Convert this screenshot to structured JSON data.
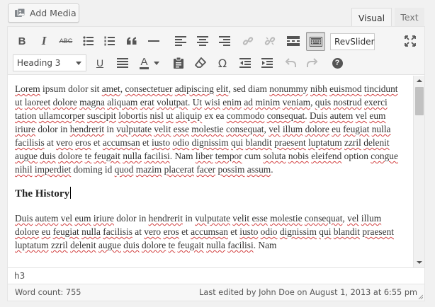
{
  "add_media": {
    "label": "Add Media",
    "icon": "media-icon"
  },
  "tabs": [
    {
      "label": "Visual",
      "active": true
    },
    {
      "label": "Text",
      "active": false
    }
  ],
  "toolbar": {
    "row1": [
      "bold",
      "italic",
      "strikethrough",
      "bullet-list",
      "numbered-list",
      "blockquote",
      "horizontal-rule",
      "align-left",
      "align-center",
      "align-right",
      "insert-link",
      "remove-link",
      "read-more",
      "toolbar-toggle",
      "revslider",
      "fullscreen"
    ],
    "row2": [
      "format-select",
      "underline",
      "justify",
      "text-color",
      "paste-as-text",
      "clear-formatting",
      "special-character",
      "decrease-indent",
      "increase-indent",
      "undo",
      "redo",
      "help"
    ],
    "bold_glyph": "B",
    "italic_glyph": "I",
    "strike_glyph": "ABC",
    "underline_glyph": "U",
    "color_glyph": "A",
    "omega_glyph": "Ω",
    "help_glyph": "?",
    "revslider_label": "RevSlider",
    "format_value": "Heading 3"
  },
  "content": {
    "paragraph1": [
      {
        "t": "Lorem",
        "sp": true
      },
      {
        "t": " ipsum dolor sit ",
        "sp": false
      },
      {
        "t": "amet",
        "sp": true
      },
      {
        "t": ", ",
        "sp": false
      },
      {
        "t": "consectetuer",
        "sp": true
      },
      {
        "t": " ",
        "sp": false
      },
      {
        "t": "adipiscing",
        "sp": true
      },
      {
        "t": " ",
        "sp": false
      },
      {
        "t": "elit",
        "sp": true
      },
      {
        "t": ", sed diam ",
        "sp": false
      },
      {
        "t": "nonummy",
        "sp": true
      },
      {
        "t": " ",
        "sp": false
      },
      {
        "t": "nibh",
        "sp": true
      },
      {
        "t": " ",
        "sp": false
      },
      {
        "t": "euismod",
        "sp": true
      },
      {
        "t": " ",
        "sp": false
      },
      {
        "t": "tincidunt",
        "sp": true
      },
      {
        "t": " ",
        "sp": false
      },
      {
        "t": "ut",
        "sp": true
      },
      {
        "t": " ",
        "sp": false
      },
      {
        "t": "laoreet",
        "sp": true
      },
      {
        "t": " ",
        "sp": false
      },
      {
        "t": "dolore",
        "sp": true
      },
      {
        "t": " ",
        "sp": false
      },
      {
        "t": "magna",
        "sp": true
      },
      {
        "t": " ",
        "sp": false
      },
      {
        "t": "aliquam",
        "sp": true
      },
      {
        "t": " ",
        "sp": false
      },
      {
        "t": "erat",
        "sp": true
      },
      {
        "t": " ",
        "sp": false
      },
      {
        "t": "volutpat",
        "sp": true
      },
      {
        "t": ". ",
        "sp": false
      },
      {
        "t": "Ut",
        "sp": true
      },
      {
        "t": " ",
        "sp": false
      },
      {
        "t": "wisi",
        "sp": true
      },
      {
        "t": " ",
        "sp": false
      },
      {
        "t": "enim",
        "sp": true
      },
      {
        "t": " ",
        "sp": false
      },
      {
        "t": "ad",
        "sp": true
      },
      {
        "t": " ",
        "sp": false
      },
      {
        "t": "minim",
        "sp": true
      },
      {
        "t": " ",
        "sp": false
      },
      {
        "t": "veniam",
        "sp": true
      },
      {
        "t": ", ",
        "sp": false
      },
      {
        "t": "quis",
        "sp": true
      },
      {
        "t": " ",
        "sp": false
      },
      {
        "t": "nostrud",
        "sp": true
      },
      {
        "t": " ",
        "sp": false
      },
      {
        "t": "exerci",
        "sp": true
      },
      {
        "t": " ",
        "sp": false
      },
      {
        "t": "tation",
        "sp": true
      },
      {
        "t": " ",
        "sp": false
      },
      {
        "t": "ullamcorper",
        "sp": true
      },
      {
        "t": " ",
        "sp": false
      },
      {
        "t": "suscipit",
        "sp": true
      },
      {
        "t": " ",
        "sp": false
      },
      {
        "t": "lobortis",
        "sp": true
      },
      {
        "t": " ",
        "sp": false
      },
      {
        "t": "nisl",
        "sp": true
      },
      {
        "t": " ",
        "sp": false
      },
      {
        "t": "ut",
        "sp": true
      },
      {
        "t": " ",
        "sp": false
      },
      {
        "t": "aliquip",
        "sp": true
      },
      {
        "t": " ex ea ",
        "sp": false
      },
      {
        "t": "commodo",
        "sp": true
      },
      {
        "t": " ",
        "sp": false
      },
      {
        "t": "consequat",
        "sp": true
      },
      {
        "t": ". ",
        "sp": false
      },
      {
        "t": "Duis",
        "sp": true
      },
      {
        "t": " ",
        "sp": false
      },
      {
        "t": "autem",
        "sp": true
      },
      {
        "t": " ",
        "sp": false
      },
      {
        "t": "vel",
        "sp": true
      },
      {
        "t": " ",
        "sp": false
      },
      {
        "t": "eum",
        "sp": true
      },
      {
        "t": " ",
        "sp": false
      },
      {
        "t": "iriure",
        "sp": true
      },
      {
        "t": " dolor in ",
        "sp": false
      },
      {
        "t": "hendrerit",
        "sp": true
      },
      {
        "t": " in ",
        "sp": false
      },
      {
        "t": "vulputate",
        "sp": true
      },
      {
        "t": " ",
        "sp": false
      },
      {
        "t": "velit",
        "sp": true
      },
      {
        "t": " ",
        "sp": false
      },
      {
        "t": "esse",
        "sp": true
      },
      {
        "t": " ",
        "sp": false
      },
      {
        "t": "molestie",
        "sp": true
      },
      {
        "t": " ",
        "sp": false
      },
      {
        "t": "consequat",
        "sp": true
      },
      {
        "t": ", ",
        "sp": false
      },
      {
        "t": "vel",
        "sp": true
      },
      {
        "t": " ",
        "sp": false
      },
      {
        "t": "illum",
        "sp": true
      },
      {
        "t": " ",
        "sp": false
      },
      {
        "t": "dolore",
        "sp": true
      },
      {
        "t": " ",
        "sp": false
      },
      {
        "t": "eu",
        "sp": true
      },
      {
        "t": " ",
        "sp": false
      },
      {
        "t": "feugiat",
        "sp": true
      },
      {
        "t": " ",
        "sp": false
      },
      {
        "t": "nulla",
        "sp": true
      },
      {
        "t": " ",
        "sp": false
      },
      {
        "t": "facilisis",
        "sp": true
      },
      {
        "t": " at ",
        "sp": false
      },
      {
        "t": "vero",
        "sp": true
      },
      {
        "t": " ",
        "sp": false
      },
      {
        "t": "eros",
        "sp": true
      },
      {
        "t": " et ",
        "sp": false
      },
      {
        "t": "accumsan",
        "sp": true
      },
      {
        "t": " et ",
        "sp": false
      },
      {
        "t": "iusto",
        "sp": true
      },
      {
        "t": " ",
        "sp": false
      },
      {
        "t": "odio",
        "sp": true
      },
      {
        "t": " ",
        "sp": false
      },
      {
        "t": "dignissim",
        "sp": true
      },
      {
        "t": " ",
        "sp": false
      },
      {
        "t": "qui",
        "sp": true
      },
      {
        "t": " ",
        "sp": false
      },
      {
        "t": "blandit",
        "sp": true
      },
      {
        "t": " ",
        "sp": false
      },
      {
        "t": "praesent",
        "sp": true
      },
      {
        "t": " ",
        "sp": false
      },
      {
        "t": "luptatum",
        "sp": true
      },
      {
        "t": " ",
        "sp": false
      },
      {
        "t": "zzril",
        "sp": true
      },
      {
        "t": " ",
        "sp": false
      },
      {
        "t": "delenit",
        "sp": true
      },
      {
        "t": " ",
        "sp": false
      },
      {
        "t": "augue",
        "sp": true
      },
      {
        "t": " ",
        "sp": false
      },
      {
        "t": "duis",
        "sp": true
      },
      {
        "t": " ",
        "sp": false
      },
      {
        "t": "dolore",
        "sp": true
      },
      {
        "t": " ",
        "sp": false
      },
      {
        "t": "te",
        "sp": true
      },
      {
        "t": " ",
        "sp": false
      },
      {
        "t": "feugait",
        "sp": true
      },
      {
        "t": " ",
        "sp": false
      },
      {
        "t": "nulla",
        "sp": true
      },
      {
        "t": " ",
        "sp": false
      },
      {
        "t": "facilisi",
        "sp": true
      },
      {
        "t": ". Nam ",
        "sp": false
      },
      {
        "t": "liber",
        "sp": true
      },
      {
        "t": " ",
        "sp": false
      },
      {
        "t": "tempor",
        "sp": true
      },
      {
        "t": " cum ",
        "sp": false
      },
      {
        "t": "soluta",
        "sp": true
      },
      {
        "t": " ",
        "sp": false
      },
      {
        "t": "nobis",
        "sp": true
      },
      {
        "t": " ",
        "sp": false
      },
      {
        "t": "eleifend",
        "sp": true
      },
      {
        "t": " option ",
        "sp": false
      },
      {
        "t": "congue",
        "sp": true
      },
      {
        "t": " ",
        "sp": false
      },
      {
        "t": "nihil",
        "sp": true
      },
      {
        "t": " ",
        "sp": false
      },
      {
        "t": "imperdiet",
        "sp": true
      },
      {
        "t": " doming id ",
        "sp": false
      },
      {
        "t": "quod",
        "sp": true
      },
      {
        "t": " ",
        "sp": false
      },
      {
        "t": "mazim",
        "sp": true
      },
      {
        "t": " ",
        "sp": false
      },
      {
        "t": "placerat",
        "sp": true
      },
      {
        "t": " ",
        "sp": false
      },
      {
        "t": "facer",
        "sp": true
      },
      {
        "t": " ",
        "sp": false
      },
      {
        "t": "possim",
        "sp": true
      },
      {
        "t": " ",
        "sp": false
      },
      {
        "t": "assum",
        "sp": true
      },
      {
        "t": ".",
        "sp": false
      }
    ],
    "heading": "The History",
    "paragraph2": [
      {
        "t": "Duis",
        "sp": true
      },
      {
        "t": " ",
        "sp": false
      },
      {
        "t": "autem",
        "sp": true
      },
      {
        "t": " ",
        "sp": false
      },
      {
        "t": "vel",
        "sp": true
      },
      {
        "t": " ",
        "sp": false
      },
      {
        "t": "eum",
        "sp": true
      },
      {
        "t": " ",
        "sp": false
      },
      {
        "t": "iriure",
        "sp": true
      },
      {
        "t": " dolor in ",
        "sp": false
      },
      {
        "t": "hendrerit",
        "sp": true
      },
      {
        "t": " in ",
        "sp": false
      },
      {
        "t": "vulputate",
        "sp": true
      },
      {
        "t": " ",
        "sp": false
      },
      {
        "t": "velit",
        "sp": true
      },
      {
        "t": " ",
        "sp": false
      },
      {
        "t": "esse",
        "sp": true
      },
      {
        "t": " ",
        "sp": false
      },
      {
        "t": "molestie",
        "sp": true
      },
      {
        "t": " ",
        "sp": false
      },
      {
        "t": "consequat",
        "sp": true
      },
      {
        "t": ", ",
        "sp": false
      },
      {
        "t": "vel",
        "sp": true
      },
      {
        "t": " ",
        "sp": false
      },
      {
        "t": "illum",
        "sp": true
      },
      {
        "t": " ",
        "sp": false
      },
      {
        "t": "dolore",
        "sp": true
      },
      {
        "t": " ",
        "sp": false
      },
      {
        "t": "eu",
        "sp": true
      },
      {
        "t": " ",
        "sp": false
      },
      {
        "t": "feugiat",
        "sp": true
      },
      {
        "t": " ",
        "sp": false
      },
      {
        "t": "nulla",
        "sp": true
      },
      {
        "t": " ",
        "sp": false
      },
      {
        "t": "facilisis",
        "sp": true
      },
      {
        "t": " at ",
        "sp": false
      },
      {
        "t": "vero",
        "sp": true
      },
      {
        "t": " ",
        "sp": false
      },
      {
        "t": "eros",
        "sp": true
      },
      {
        "t": " et ",
        "sp": false
      },
      {
        "t": "accumsan",
        "sp": true
      },
      {
        "t": " et ",
        "sp": false
      },
      {
        "t": "iusto",
        "sp": true
      },
      {
        "t": " ",
        "sp": false
      },
      {
        "t": "odio",
        "sp": true
      },
      {
        "t": " ",
        "sp": false
      },
      {
        "t": "dignissim",
        "sp": true
      },
      {
        "t": " ",
        "sp": false
      },
      {
        "t": "qui",
        "sp": true
      },
      {
        "t": " ",
        "sp": false
      },
      {
        "t": "blandit",
        "sp": true
      },
      {
        "t": " ",
        "sp": false
      },
      {
        "t": "praesent",
        "sp": true
      },
      {
        "t": " ",
        "sp": false
      },
      {
        "t": "luptatum",
        "sp": true
      },
      {
        "t": " ",
        "sp": false
      },
      {
        "t": "zzril",
        "sp": true
      },
      {
        "t": " ",
        "sp": false
      },
      {
        "t": "delenit",
        "sp": true
      },
      {
        "t": " ",
        "sp": false
      },
      {
        "t": "augue",
        "sp": true
      },
      {
        "t": " ",
        "sp": false
      },
      {
        "t": "duis",
        "sp": true
      },
      {
        "t": " ",
        "sp": false
      },
      {
        "t": "dolore",
        "sp": true
      },
      {
        "t": " ",
        "sp": false
      },
      {
        "t": "te",
        "sp": true
      },
      {
        "t": " ",
        "sp": false
      },
      {
        "t": "feugait",
        "sp": true
      },
      {
        "t": " ",
        "sp": false
      },
      {
        "t": "nulla",
        "sp": true
      },
      {
        "t": " ",
        "sp": false
      },
      {
        "t": "facilisi",
        "sp": true
      },
      {
        "t": ". Nam",
        "sp": false
      }
    ]
  },
  "path_bar": "h3",
  "status": {
    "word_count": "Word count: 755",
    "last_edited": "Last edited by John Doe on August 1, 2013 at 6:55 pm"
  },
  "colors": {
    "toolbar_bg": "#f5f5f5",
    "spellcheck": "#d24040",
    "active_tab_bg": "#f5f5f5"
  }
}
